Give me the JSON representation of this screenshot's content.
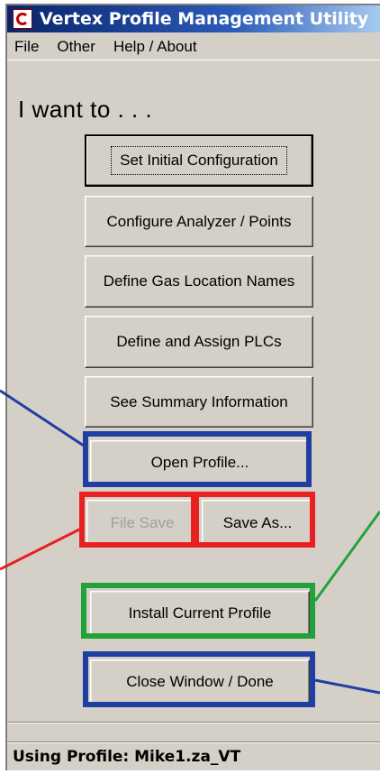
{
  "window": {
    "title": "Vertex Profile Management Utility"
  },
  "menu": {
    "items": [
      "File",
      "Other",
      "Help / About"
    ]
  },
  "heading": "I want to . . .",
  "buttons": {
    "set_initial": "Set Initial Configuration",
    "configure_analyzer": "Configure Analyzer / Points",
    "define_gas": "Define Gas Location Names",
    "define_plcs": "Define and Assign PLCs",
    "see_summary": "See Summary Information",
    "open_profile": "Open Profile...",
    "file_save": "File Save",
    "save_as": "Save As...",
    "install_profile": "Install Current Profile",
    "close_window": "Close Window / Done"
  },
  "status": {
    "text": "Using Profile:  Mike1.za_VT"
  },
  "colors": {
    "highlight_blue": "#1f3fa3",
    "highlight_red": "#e82020",
    "highlight_green": "#23a23a",
    "window_bg": "#d4d0c8"
  },
  "icons": [
    "app-logo-icon"
  ]
}
